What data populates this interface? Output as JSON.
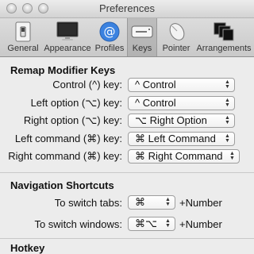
{
  "window": {
    "title": "Preferences"
  },
  "toolbar": {
    "items": [
      {
        "label": "General"
      },
      {
        "label": "Appearance"
      },
      {
        "label": "Profiles"
      },
      {
        "label": "Keys"
      },
      {
        "label": "Pointer"
      },
      {
        "label": "Arrangements"
      }
    ],
    "selected": "Keys"
  },
  "remap": {
    "heading": "Remap Modifier Keys",
    "rows": [
      {
        "label": "Control (^) key:",
        "value": "^ Control"
      },
      {
        "label": "Left option (⌥) key:",
        "value": "^ Control"
      },
      {
        "label": "Right option (⌥) key:",
        "value": "⌥ Right Option"
      },
      {
        "label": "Left command (⌘) key:",
        "value": "⌘ Left Command"
      },
      {
        "label": "Right command (⌘) key:",
        "value": "⌘ Right Command"
      }
    ]
  },
  "nav": {
    "heading": "Navigation Shortcuts",
    "rows": [
      {
        "label": "To switch tabs:",
        "value": "⌘",
        "suffix": "+Number"
      },
      {
        "label": "To switch windows:",
        "value": "⌘⌥",
        "suffix": "+Number"
      }
    ]
  },
  "hotkey": {
    "heading": "Hotkey"
  },
  "colors": {
    "selected_tab": "#b6b6b6",
    "profiles_icon": "#3b82e0"
  }
}
